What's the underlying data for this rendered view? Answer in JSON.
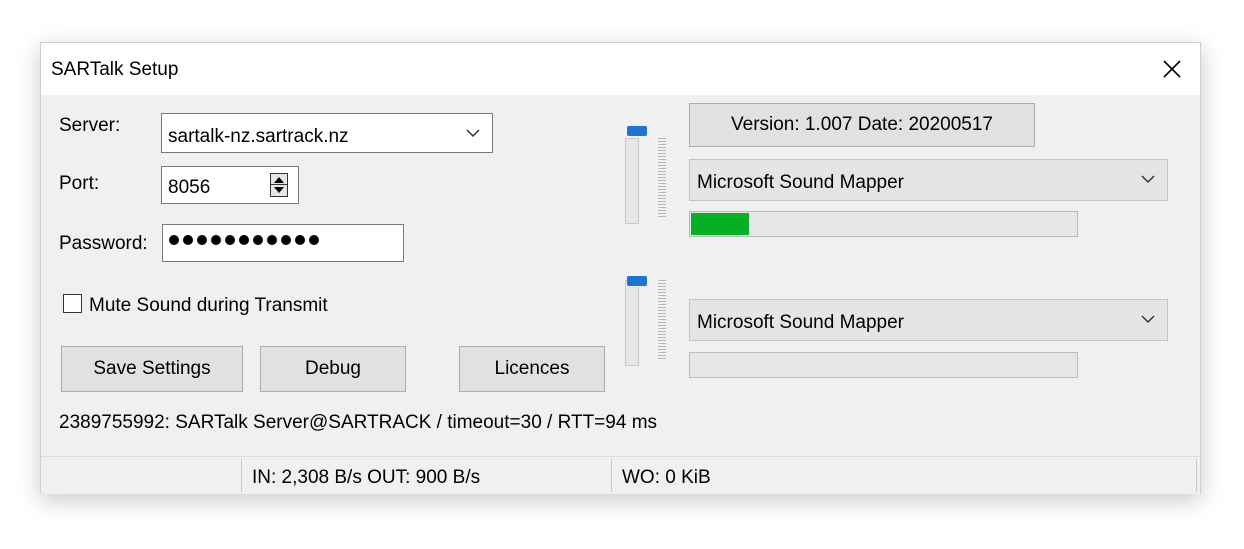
{
  "window": {
    "title": "SARTalk Setup",
    "close_icon": "close-icon"
  },
  "form": {
    "server_label": "Server:",
    "server_value": "sartalk-nz.sartrack.nz",
    "port_label": "Port:",
    "port_value": "8056",
    "password_label": "Password:",
    "password_masked_length": 11,
    "mute_label": "Mute Sound during Transmit",
    "mute_checked": false
  },
  "buttons": {
    "save": "Save Settings",
    "debug": "Debug",
    "licences": "Licences",
    "version": "Version: 1.007  Date: 20200517"
  },
  "audio": {
    "output_device": "Microsoft Sound Mapper",
    "output_level_fraction": 0.15,
    "input_device": "Microsoft Sound Mapper",
    "input_level_fraction": 0,
    "level_color": "#06b025"
  },
  "status_line": "2389755992: SARTalk Server@SARTRACK /  timeout=30 / RTT=94 ms",
  "statusbar": {
    "panel1": "",
    "traffic": "IN: 2,308 B/s  OUT: 900 B/s",
    "wo": "WO: 0 KiB"
  }
}
